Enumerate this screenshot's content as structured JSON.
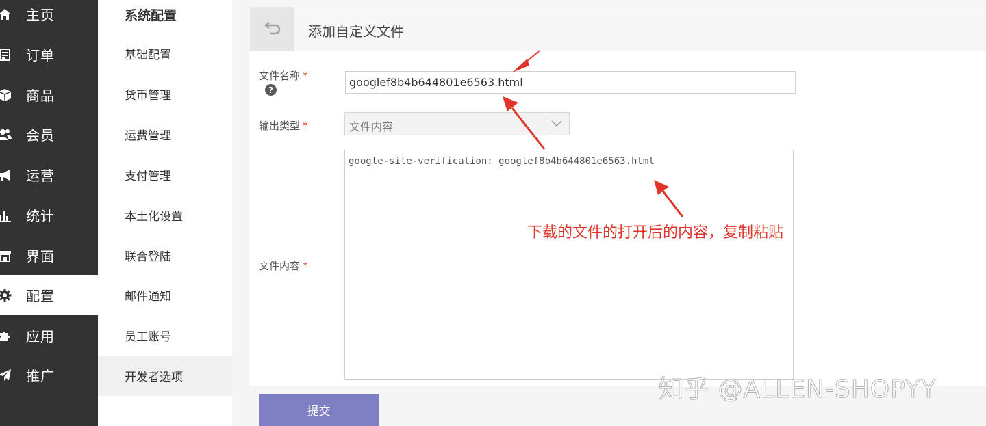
{
  "main_nav": [
    {
      "label": "主页",
      "icon": "home-icon"
    },
    {
      "label": "订单",
      "icon": "order-list-icon"
    },
    {
      "label": "商品",
      "icon": "box-icon"
    },
    {
      "label": "会员",
      "icon": "users-icon"
    },
    {
      "label": "运营",
      "icon": "megaphone-icon"
    },
    {
      "label": "统计",
      "icon": "bar-chart-icon"
    },
    {
      "label": "界面",
      "icon": "storefront-icon"
    },
    {
      "label": "配置",
      "icon": "gear-icon",
      "active": true
    },
    {
      "label": "应用",
      "icon": "puzzle-icon"
    },
    {
      "label": "推广",
      "icon": "paper-plane-icon"
    }
  ],
  "sub_nav": {
    "title": "系统配置",
    "items": [
      {
        "label": "基础配置"
      },
      {
        "label": "货币管理"
      },
      {
        "label": "运费管理"
      },
      {
        "label": "支付管理"
      },
      {
        "label": "本土化设置"
      },
      {
        "label": "联合登陆"
      },
      {
        "label": "邮件通知"
      },
      {
        "label": "员工账号"
      },
      {
        "label": "开发者选项",
        "active": true
      }
    ]
  },
  "panel": {
    "title": "添加自定义文件",
    "back_icon": "undo-arrow-icon"
  },
  "form": {
    "filename": {
      "label": "文件名称",
      "required": "*",
      "value": "googlef8b4b644801e6563.html",
      "help": "?"
    },
    "output_type": {
      "label": "输出类型",
      "required": "*",
      "value": "文件内容"
    },
    "content": {
      "label": "文件内容",
      "required": "*",
      "value": "google-site-verification: googlef8b4b644801e6563.html"
    },
    "submit_label": "提交"
  },
  "annotation": {
    "text": "下载的文件的打开后的内容，复制粘贴",
    "color": "#e0352b"
  },
  "watermark": "知乎 @ALLEN-SHOPYY",
  "colors": {
    "nav_bg": "#333333",
    "submit_bg": "#7f7fc4",
    "required": "#d9342b"
  }
}
